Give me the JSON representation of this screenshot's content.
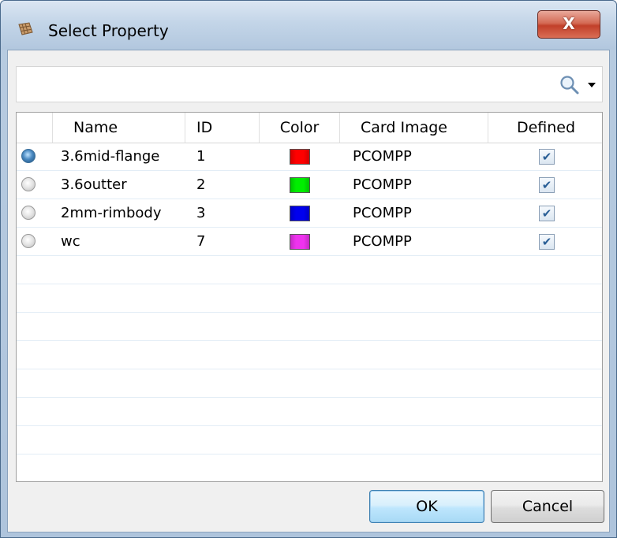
{
  "window": {
    "title": "Select Property",
    "close_label": "X"
  },
  "search": {
    "value": "",
    "placeholder": ""
  },
  "table": {
    "columns": [
      "",
      "Name",
      "ID",
      "Color",
      "Card Image",
      "Defined"
    ],
    "rows": [
      {
        "selected": true,
        "name": "3.6mid-flange",
        "id": "1",
        "color": "#ff0000",
        "card_image": "PCOMPP",
        "defined": true
      },
      {
        "selected": false,
        "name": "3.6outter",
        "id": "2",
        "color": "#00ee00",
        "card_image": "PCOMPP",
        "defined": true
      },
      {
        "selected": false,
        "name": "2mm-rimbody",
        "id": "3",
        "color": "#0000ee",
        "card_image": "PCOMPP",
        "defined": true
      },
      {
        "selected": false,
        "name": "wc",
        "id": "7",
        "color": "#ee33ee",
        "card_image": "PCOMPP",
        "defined": true
      }
    ]
  },
  "buttons": {
    "ok": "OK",
    "cancel": "Cancel"
  },
  "icons": {
    "window": "property-grid-icon",
    "search": "search-icon",
    "dropdown": "chevron-down-icon",
    "check": "✔"
  }
}
